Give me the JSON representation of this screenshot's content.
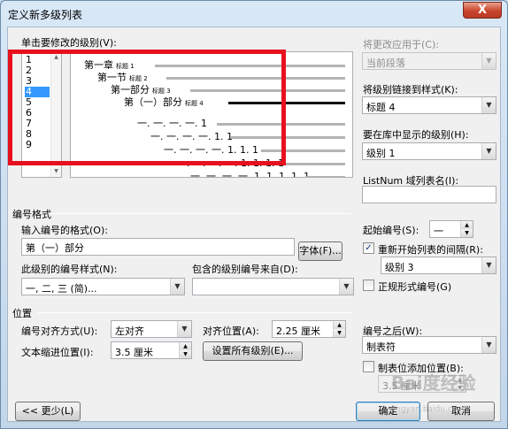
{
  "window": {
    "title": "定义新多级列表",
    "close_glyph": "X"
  },
  "level_section": {
    "label": "单击要修改的级别(V):",
    "levels": [
      "1",
      "2",
      "3",
      "4",
      "5",
      "6",
      "7",
      "8",
      "9"
    ],
    "selected": "4"
  },
  "preview": {
    "rows": [
      {
        "text": "第一章",
        "style": "标题 1"
      },
      {
        "text": "第一节",
        "style": "标题 2"
      },
      {
        "text": "第一部分",
        "style": "标题 3"
      },
      {
        "text": "第（一）部分",
        "style": "标题 4"
      },
      {
        "text": "一. 一. 一. 一. 1"
      },
      {
        "text": "一. 一. 一. 一. 1. 1"
      },
      {
        "text": "一. 一. 一. 一. 1. 1. 1"
      },
      {
        "text": "一. 一. 一. 一. 1. 1. 1. 1"
      },
      {
        "text": "一. 一. 一. 一. 1. 1. 1. 1. 1"
      }
    ]
  },
  "right_panel": {
    "apply_label": "将更改应用于(C):",
    "apply_value": "当前段落",
    "link_label": "将级别链接到样式(K):",
    "link_value": "标题 4",
    "gallery_label": "要在库中显示的级别(H):",
    "gallery_value": "级别 1",
    "listnum_label": "ListNum 域列表名(I):",
    "listnum_value": "",
    "start_label": "起始编号(S):",
    "start_value": "一",
    "restart_label": "重新开始列表的间隔(R):",
    "restart_checked": "✓",
    "restart_value": "级别 3",
    "legal_label": "正规形式编号(G)",
    "after_label": "编号之后(W):",
    "after_value": "制表符",
    "tabstop_label": "制表位添加位置(B):",
    "tabstop_value": "3.5 厘米"
  },
  "number_format": {
    "group_label": "编号格式",
    "input_label": "输入编号的格式(O):",
    "input_value": "第（一）部分",
    "font_button": "字体(F)...",
    "style_label": "此级别的编号样式(N):",
    "style_value": "一, 二, 三 (简)...",
    "include_label": "包含的级别编号来自(D):",
    "include_value": ""
  },
  "position": {
    "group_label": "位置",
    "align_label": "编号对齐方式(U):",
    "align_value": "左对齐",
    "align_at_label": "对齐位置(A):",
    "align_at_value": "2.25 厘米",
    "indent_label": "文本缩进位置(I):",
    "indent_value": "3.5 厘米",
    "set_all_button": "设置所有级别(E)..."
  },
  "footer": {
    "less_button": "<< 更少(L)",
    "ok_button": "确定",
    "cancel_button": "取消"
  },
  "watermark": {
    "text": "Bai度经验",
    "sub": "jingyan.baidu.com"
  }
}
